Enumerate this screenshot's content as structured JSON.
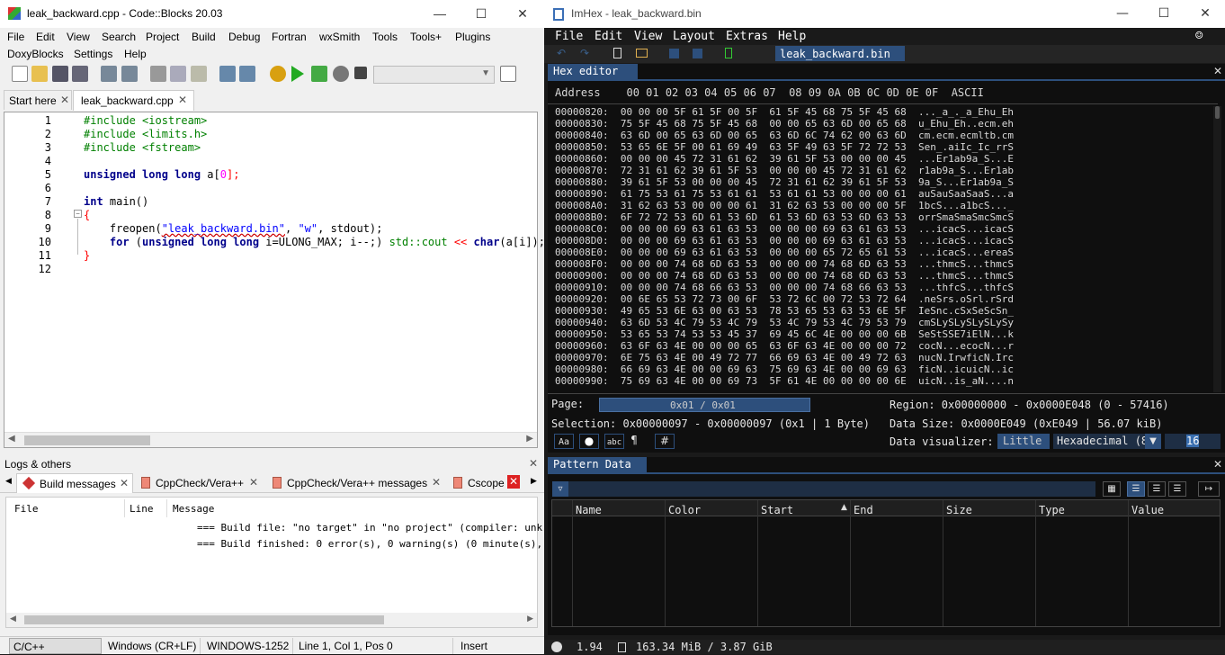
{
  "codeblocks": {
    "title": "leak_backward.cpp - Code::Blocks 20.03",
    "menu1": [
      "File",
      "Edit",
      "View",
      "Search",
      "Project",
      "Build",
      "Debug",
      "Fortran",
      "wxSmith",
      "Tools",
      "Tools+",
      "Plugins"
    ],
    "menu2": [
      "DoxyBlocks",
      "Settings",
      "Help"
    ],
    "tabs": [
      {
        "label": "Start here"
      },
      {
        "label": "leak_backward.cpp"
      }
    ],
    "line_numbers": [
      "1",
      "2",
      "3",
      "4",
      "5",
      "6",
      "7",
      "8",
      "9",
      "10",
      "11",
      "12"
    ],
    "code": {
      "l1": "#include <iostream>",
      "l2": "#include <limits.h>",
      "l3": "#include <fstream>",
      "l5a": "unsigned long long",
      "l5b": " a[",
      "l5c": "0",
      "l5d": "];",
      "l7a": "int",
      "l7b": " main()",
      "l8": "{",
      "l9a": "    freopen(",
      "l9b": "\"leak_backward.bin\"",
      "l9c": ", ",
      "l9d": "\"w\"",
      "l9e": ", stdout);",
      "l10a": "    for",
      "l10b": " (",
      "l10c": "unsigned long long",
      "l10d": " i=ULONG_MAX; i--;) ",
      "l10e": "std::cout",
      "l10f": " << ",
      "l10g": "char",
      "l10h": "(a[i]);",
      "l11": "}"
    },
    "logs": {
      "header": "Logs & others",
      "tabs": [
        "Build messages",
        "CppCheck/Vera++",
        "CppCheck/Vera++ messages",
        "Cscope"
      ],
      "columns": [
        "File",
        "Line",
        "Message"
      ],
      "rows": [
        "=== Build file: \"no target\" in \"no project\" (compiler: unk",
        "=== Build finished: 0 error(s), 0 warning(s) (0 minute(s),"
      ]
    },
    "status": [
      "C/C++",
      "Windows (CR+LF)",
      "WINDOWS-1252",
      "Line 1, Col 1, Pos 0",
      "Insert"
    ]
  },
  "imhex": {
    "title": "ImHex - leak_backward.bin",
    "menu": [
      "File",
      "Edit",
      "View",
      "Layout",
      "Extras",
      "Help"
    ],
    "file_tab": "leak_backward.bin",
    "hex_editor_tab": "Hex editor",
    "header": "Address    00 01 02 03 04 05 06 07  08 09 0A 0B 0C 0D 0E 0F  ASCII",
    "rows": [
      "00000820:  00 00 00 5F 61 5F 00 5F  61 5F 45 68 75 5F 45 68  ..._a_._a_Ehu_Eh",
      "00000830:  75 5F 45 68 75 5F 45 68  00 00 65 63 6D 00 65 68  u_Ehu_Eh..ecm.eh",
      "00000840:  63 6D 00 65 63 6D 00 65  63 6D 6C 74 62 00 63 6D  cm.ecm.ecmltb.cm",
      "00000850:  53 65 6E 5F 00 61 69 49  63 5F 49 63 5F 72 72 53  Sen_.aiIc_Ic_rrS",
      "00000860:  00 00 00 45 72 31 61 62  39 61 5F 53 00 00 00 45  ...Er1ab9a_S...E",
      "00000870:  72 31 61 62 39 61 5F 53  00 00 00 45 72 31 61 62  r1ab9a_S...Er1ab",
      "00000880:  39 61 5F 53 00 00 00 45  72 31 61 62 39 61 5F 53  9a_S...Er1ab9a_S",
      "00000890:  61 75 53 61 75 53 61 61  53 61 61 53 00 00 00 61  auSauSaaSaaS...a",
      "000008A0:  31 62 63 53 00 00 00 61  31 62 63 53 00 00 00 5F  1bcS...a1bcS..._",
      "000008B0:  6F 72 72 53 6D 61 53 6D  61 53 6D 63 53 6D 63 53  orrSmaSmaSmcSmcS",
      "000008C0:  00 00 00 69 63 61 63 53  00 00 00 69 63 61 63 53  ...icacS...icacS",
      "000008D0:  00 00 00 69 63 61 63 53  00 00 00 69 63 61 63 53  ...icacS...icacS",
      "000008E0:  00 00 00 69 63 61 63 53  00 00 00 65 72 65 61 53  ...icacS...ereaS",
      "000008F0:  00 00 00 74 68 6D 63 53  00 00 00 74 68 6D 63 53  ...thmcS...thmcS",
      "00000900:  00 00 00 74 68 6D 63 53  00 00 00 74 68 6D 63 53  ...thmcS...thmcS",
      "00000910:  00 00 00 74 68 66 63 53  00 00 00 74 68 66 63 53  ...thfcS...thfcS",
      "00000920:  00 6E 65 53 72 73 00 6F  53 72 6C 00 72 53 72 64  .neSrs.oSrl.rSrd",
      "00000930:  49 65 53 6E 63 00 63 53  78 53 65 53 63 53 6E 5F  IeSnc.cSxSeScSn_",
      "00000940:  63 6D 53 4C 79 53 4C 79  53 4C 79 53 4C 79 53 79  cmSLySLySLySLySy",
      "00000950:  53 65 53 74 53 53 45 37  69 45 6C 4E 00 00 00 6B  SeStSSE7iElN...k",
      "00000960:  63 6F 63 4E 00 00 00 65  63 6F 63 4E 00 00 00 72  cocN...ecocN...r",
      "00000970:  6E 75 63 4E 00 49 72 77  66 69 63 4E 00 49 72 63  nucN.IrwficN.Irc",
      "00000980:  66 69 63 4E 00 00 69 63  75 69 63 4E 00 00 69 63  ficN..icuicN..ic",
      "00000990:  75 69 63 4E 00 00 69 73  5F 61 4E 00 00 00 00 6E  uicN..is_aN....n"
    ],
    "page_label": "Page:",
    "page_value": "0x01 / 0x01",
    "region": "Region: 0x00000000 - 0x0000E048 (0 - 57416)",
    "selection": "Selection: 0x00000097 - 0x00000097 (0x1 | 1 Byte)",
    "data_size": "Data Size: 0x0000E049 (0xE049 | 56.07 kiB)",
    "visualizer_label": "Data visualizer:",
    "endian": "Little",
    "visualizer_mode": "Hexadecimal (8",
    "visualizer_cols": "16",
    "footer_buttons": [
      "Aa",
      "abc"
    ],
    "pattern_tab": "Pattern Data",
    "pattern_columns": [
      "Name",
      "Color",
      "Start",
      "End",
      "Size",
      "Type",
      "Value"
    ],
    "fps": "1.94",
    "memory": "163.34 MiB / 3.87 GiB"
  }
}
